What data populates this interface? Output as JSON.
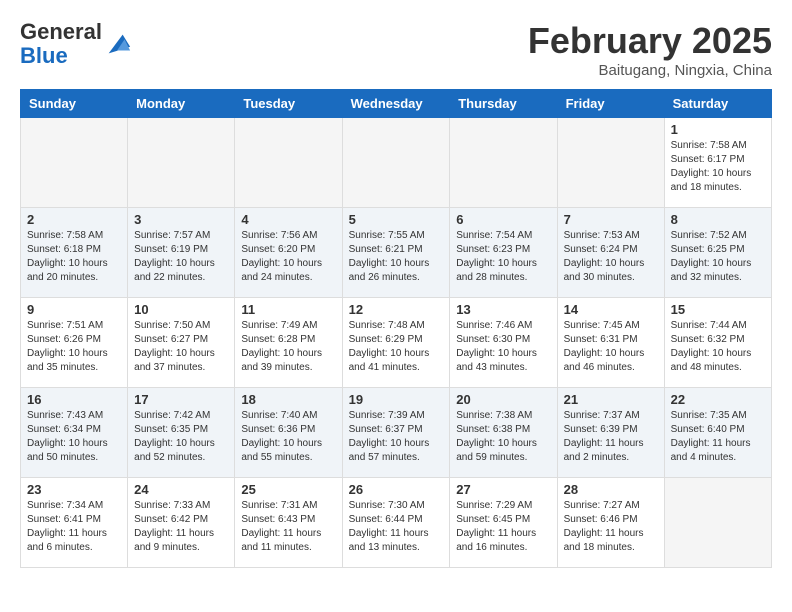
{
  "header": {
    "logo_line1": "General",
    "logo_line2": "Blue",
    "month_title": "February 2025",
    "location": "Baitugang, Ningxia, China"
  },
  "weekdays": [
    "Sunday",
    "Monday",
    "Tuesday",
    "Wednesday",
    "Thursday",
    "Friday",
    "Saturday"
  ],
  "weeks": [
    [
      {
        "day": "",
        "info": ""
      },
      {
        "day": "",
        "info": ""
      },
      {
        "day": "",
        "info": ""
      },
      {
        "day": "",
        "info": ""
      },
      {
        "day": "",
        "info": ""
      },
      {
        "day": "",
        "info": ""
      },
      {
        "day": "1",
        "info": "Sunrise: 7:58 AM\nSunset: 6:17 PM\nDaylight: 10 hours and 18 minutes."
      }
    ],
    [
      {
        "day": "2",
        "info": "Sunrise: 7:58 AM\nSunset: 6:18 PM\nDaylight: 10 hours and 20 minutes."
      },
      {
        "day": "3",
        "info": "Sunrise: 7:57 AM\nSunset: 6:19 PM\nDaylight: 10 hours and 22 minutes."
      },
      {
        "day": "4",
        "info": "Sunrise: 7:56 AM\nSunset: 6:20 PM\nDaylight: 10 hours and 24 minutes."
      },
      {
        "day": "5",
        "info": "Sunrise: 7:55 AM\nSunset: 6:21 PM\nDaylight: 10 hours and 26 minutes."
      },
      {
        "day": "6",
        "info": "Sunrise: 7:54 AM\nSunset: 6:23 PM\nDaylight: 10 hours and 28 minutes."
      },
      {
        "day": "7",
        "info": "Sunrise: 7:53 AM\nSunset: 6:24 PM\nDaylight: 10 hours and 30 minutes."
      },
      {
        "day": "8",
        "info": "Sunrise: 7:52 AM\nSunset: 6:25 PM\nDaylight: 10 hours and 32 minutes."
      }
    ],
    [
      {
        "day": "9",
        "info": "Sunrise: 7:51 AM\nSunset: 6:26 PM\nDaylight: 10 hours and 35 minutes."
      },
      {
        "day": "10",
        "info": "Sunrise: 7:50 AM\nSunset: 6:27 PM\nDaylight: 10 hours and 37 minutes."
      },
      {
        "day": "11",
        "info": "Sunrise: 7:49 AM\nSunset: 6:28 PM\nDaylight: 10 hours and 39 minutes."
      },
      {
        "day": "12",
        "info": "Sunrise: 7:48 AM\nSunset: 6:29 PM\nDaylight: 10 hours and 41 minutes."
      },
      {
        "day": "13",
        "info": "Sunrise: 7:46 AM\nSunset: 6:30 PM\nDaylight: 10 hours and 43 minutes."
      },
      {
        "day": "14",
        "info": "Sunrise: 7:45 AM\nSunset: 6:31 PM\nDaylight: 10 hours and 46 minutes."
      },
      {
        "day": "15",
        "info": "Sunrise: 7:44 AM\nSunset: 6:32 PM\nDaylight: 10 hours and 48 minutes."
      }
    ],
    [
      {
        "day": "16",
        "info": "Sunrise: 7:43 AM\nSunset: 6:34 PM\nDaylight: 10 hours and 50 minutes."
      },
      {
        "day": "17",
        "info": "Sunrise: 7:42 AM\nSunset: 6:35 PM\nDaylight: 10 hours and 52 minutes."
      },
      {
        "day": "18",
        "info": "Sunrise: 7:40 AM\nSunset: 6:36 PM\nDaylight: 10 hours and 55 minutes."
      },
      {
        "day": "19",
        "info": "Sunrise: 7:39 AM\nSunset: 6:37 PM\nDaylight: 10 hours and 57 minutes."
      },
      {
        "day": "20",
        "info": "Sunrise: 7:38 AM\nSunset: 6:38 PM\nDaylight: 10 hours and 59 minutes."
      },
      {
        "day": "21",
        "info": "Sunrise: 7:37 AM\nSunset: 6:39 PM\nDaylight: 11 hours and 2 minutes."
      },
      {
        "day": "22",
        "info": "Sunrise: 7:35 AM\nSunset: 6:40 PM\nDaylight: 11 hours and 4 minutes."
      }
    ],
    [
      {
        "day": "23",
        "info": "Sunrise: 7:34 AM\nSunset: 6:41 PM\nDaylight: 11 hours and 6 minutes."
      },
      {
        "day": "24",
        "info": "Sunrise: 7:33 AM\nSunset: 6:42 PM\nDaylight: 11 hours and 9 minutes."
      },
      {
        "day": "25",
        "info": "Sunrise: 7:31 AM\nSunset: 6:43 PM\nDaylight: 11 hours and 11 minutes."
      },
      {
        "day": "26",
        "info": "Sunrise: 7:30 AM\nSunset: 6:44 PM\nDaylight: 11 hours and 13 minutes."
      },
      {
        "day": "27",
        "info": "Sunrise: 7:29 AM\nSunset: 6:45 PM\nDaylight: 11 hours and 16 minutes."
      },
      {
        "day": "28",
        "info": "Sunrise: 7:27 AM\nSunset: 6:46 PM\nDaylight: 11 hours and 18 minutes."
      },
      {
        "day": "",
        "info": ""
      }
    ]
  ]
}
